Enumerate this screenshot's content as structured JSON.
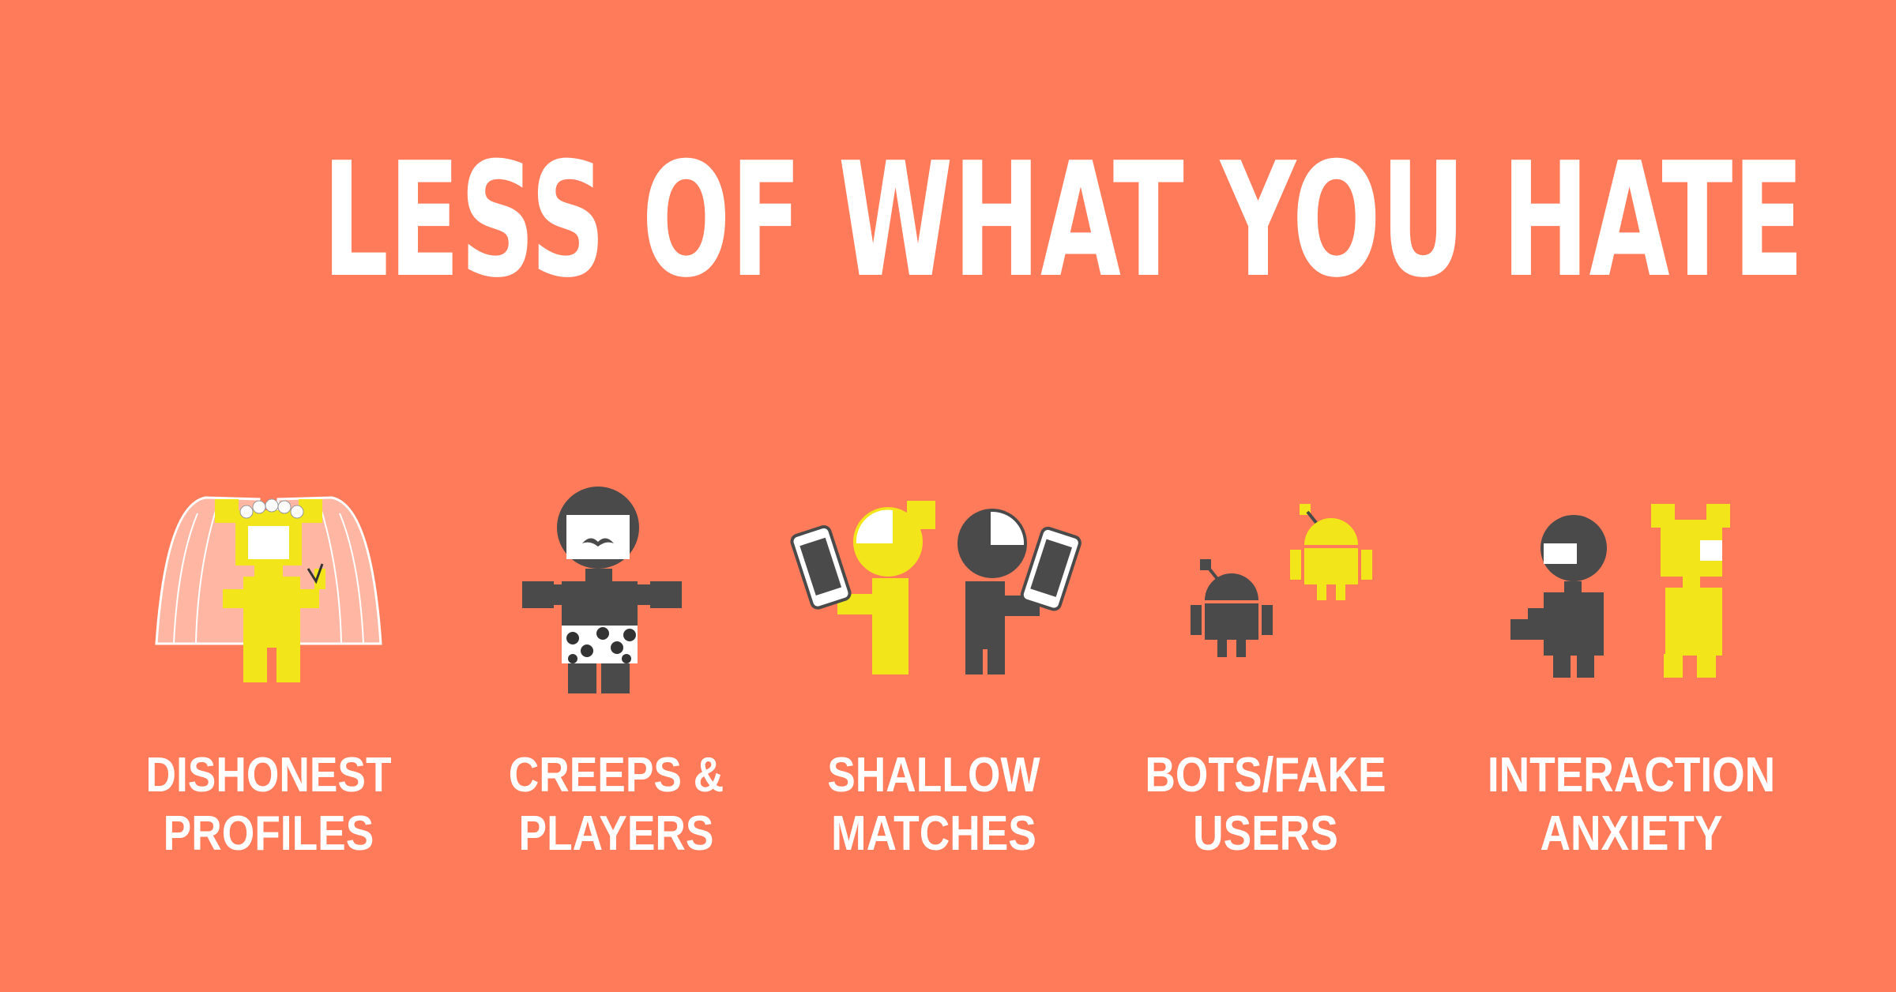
{
  "headline": "LESS OF WHAT YOU HATE",
  "colors": {
    "background": "#FF7B5A",
    "yellow": "#F2E51A",
    "gray": "#4A4A4A",
    "white": "#FFFFFF",
    "veil": "#FFB7A4"
  },
  "items": [
    {
      "line1": "DISHONEST",
      "line2": "PROFILES",
      "icon": "bride-with-veil-icon"
    },
    {
      "line1": "CREEPS &",
      "line2": "PLAYERS",
      "icon": "mustache-man-in-boxers-icon"
    },
    {
      "line1": "SHALLOW",
      "line2": "MATCHES",
      "icon": "people-on-phones-icon"
    },
    {
      "line1": "BOTS/FAKE",
      "line2": "USERS",
      "icon": "robots-icon"
    },
    {
      "line1": "INTERACTION",
      "line2": "ANXIETY",
      "icon": "awkward-couple-icon"
    }
  ]
}
